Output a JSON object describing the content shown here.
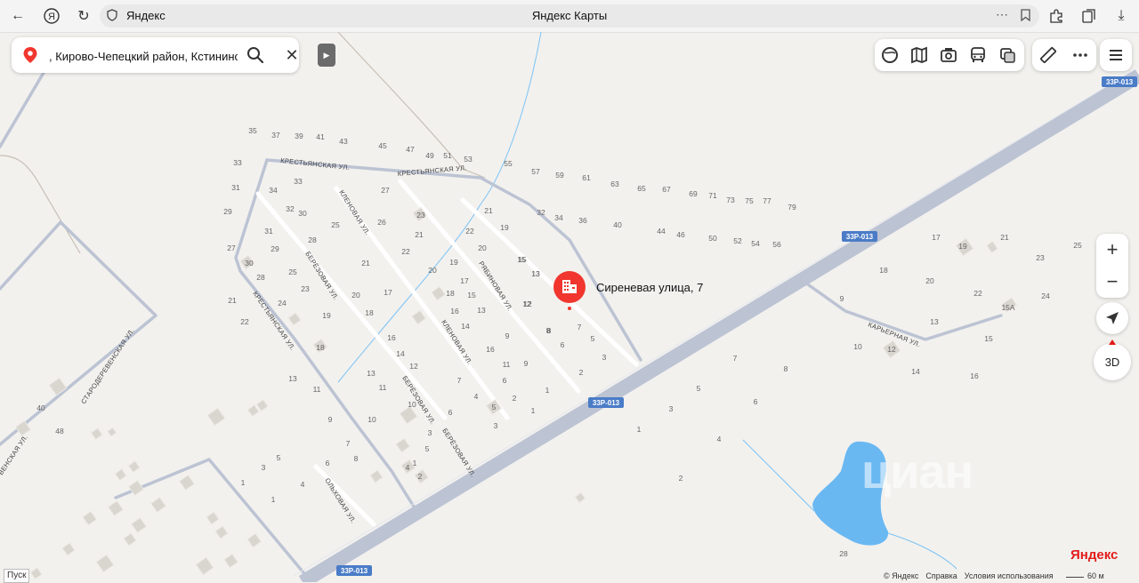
{
  "browser": {
    "domain": "Яндекс",
    "title": "Яндекс Карты"
  },
  "search": {
    "value": ", Кирово-Чепецкий район, Кстининск"
  },
  "poi": {
    "label": "Сиреневая улица, 7"
  },
  "colors": {
    "background": "#f2f1ee",
    "road_major": "#bcc3d3",
    "road_minor": "#ffffff",
    "water": "#6ab8f2",
    "poi": "#f0362e",
    "badge": "#4a7cc7"
  },
  "streets": {
    "krestyanskaya_1": "КРЕСТЬЯНСКАЯ УЛ.",
    "krestyanskaya_2": "КРЕСТЬЯНСКАЯ УЛ.",
    "krestyanskaya_3": "КРЕСТЬЯНСКАЯ УЛ.",
    "klenovaya_1": "КЛЕНОВАЯ УЛ.",
    "klenovaya_2": "КЛЕНОВАЯ УЛ.",
    "berezovaya_1": "БЕРЁЗОВАЯ УЛ.",
    "berezovaya_2": "БЕРЁЗОВАЯ УЛ.",
    "berezovaya_3": "БЕРЁЗОВАЯ УЛ.",
    "ryabinovaya": "РЯБИНОВАЯ УЛ.",
    "olkhovaya": "ОЛЬХОВАЯ УЛ.",
    "starodereveskaya": "СТАРОДЕРЕВЕНСКАЯ УЛ.",
    "venskaya": "ВЕНСКАЯ УЛ.",
    "karernaya": "КАРЬЕРНАЯ УЛ."
  },
  "road_badges": [
    "33Р-013",
    "33Р-013",
    "33Р-013",
    "33Р-013"
  ],
  "house_numbers": [
    "35",
    "37",
    "39",
    "41",
    "43",
    "45",
    "47",
    "49",
    "51",
    "53",
    "55",
    "57",
    "59",
    "61",
    "63",
    "65",
    "67",
    "69",
    "71",
    "73",
    "75",
    "77",
    "79",
    "33",
    "33",
    "31",
    "34",
    "32",
    "29",
    "31",
    "30",
    "28",
    "27",
    "30",
    "29",
    "23",
    "28",
    "25",
    "21",
    "24",
    "19",
    "22",
    "18",
    "13",
    "11",
    "27",
    "26",
    "25",
    "21",
    "20",
    "17",
    "18",
    "16",
    "14",
    "12",
    "13",
    "11",
    "10",
    "9",
    "7",
    "5",
    "3",
    "1",
    "1",
    "4",
    "6",
    "8",
    "23",
    "21",
    "22",
    "20",
    "19",
    "17",
    "15",
    "16",
    "13",
    "14",
    "9",
    "10",
    "7",
    "6",
    "5",
    "3",
    "1",
    "2",
    "4",
    "21",
    "19",
    "20",
    "22",
    "18",
    "16",
    "15",
    "13",
    "12",
    "11",
    "9",
    "8",
    "6",
    "5",
    "4",
    "3",
    "2",
    "1",
    "32",
    "34",
    "36",
    "40",
    "44",
    "46",
    "50",
    "52",
    "54",
    "56",
    "15",
    "13",
    "12",
    "8",
    "7",
    "6",
    "5",
    "3",
    "2",
    "1",
    "17",
    "19",
    "21",
    "25",
    "23",
    "18",
    "20",
    "22",
    "24",
    "15А",
    "13",
    "15",
    "14",
    "16",
    "10",
    "12",
    "9",
    "7",
    "8",
    "5",
    "6",
    "3",
    "1",
    "4",
    "2",
    "28",
    "40",
    "48"
  ],
  "controls": {
    "zoom_in": "+",
    "zoom_out": "−",
    "btn_3d": "3D",
    "pusk": "Пуск"
  },
  "footer": {
    "copyright": "© Яндекс",
    "help": "Справка",
    "terms": "Условия использования",
    "logo": "Яндекс",
    "scale": "60 м"
  },
  "watermark": "циан"
}
